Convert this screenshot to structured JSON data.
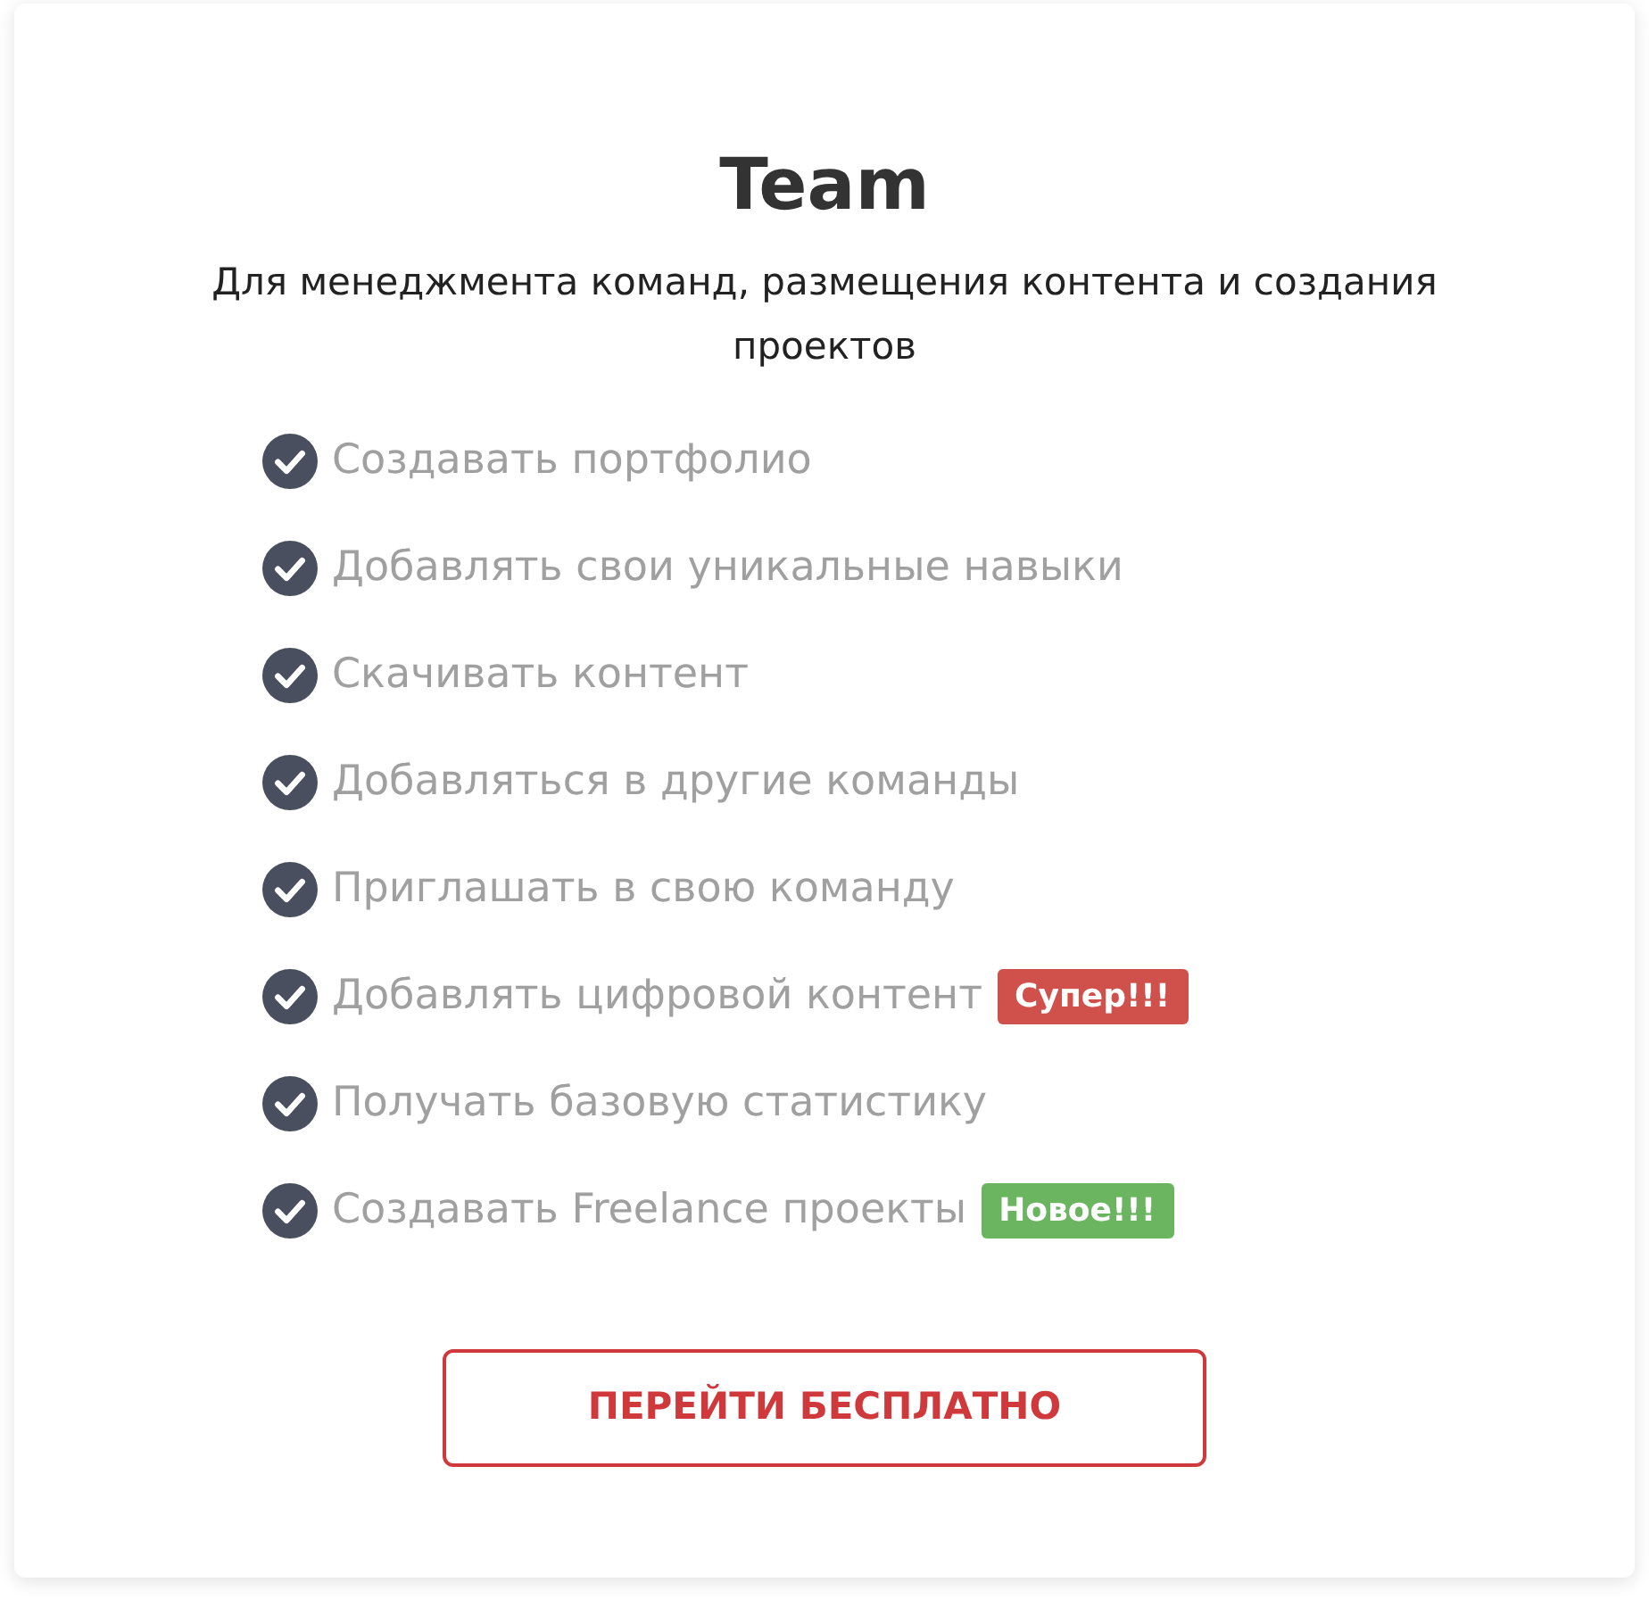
{
  "card": {
    "title": "Team",
    "subtitle": "Для менеджмента команд, размещения контента и создания проектов",
    "features": [
      {
        "text": "Создавать портфолио"
      },
      {
        "text": "Добавлять свои уникальные навыки"
      },
      {
        "text": "Скачивать контент"
      },
      {
        "text": "Добавляться в другие команды"
      },
      {
        "text": "Приглашать в свою команду"
      },
      {
        "text": "Добавлять цифровой контент",
        "badge": {
          "text": "Супер!!!",
          "color": "#d0504c"
        }
      },
      {
        "text": "Получать базовую статистику"
      },
      {
        "text": "Создавать Freelance проекты",
        "badge": {
          "text": "Новое!!!",
          "color": "#6bb561"
        }
      }
    ],
    "button": "ПЕРЕЙТИ БЕСПЛАТНО"
  }
}
